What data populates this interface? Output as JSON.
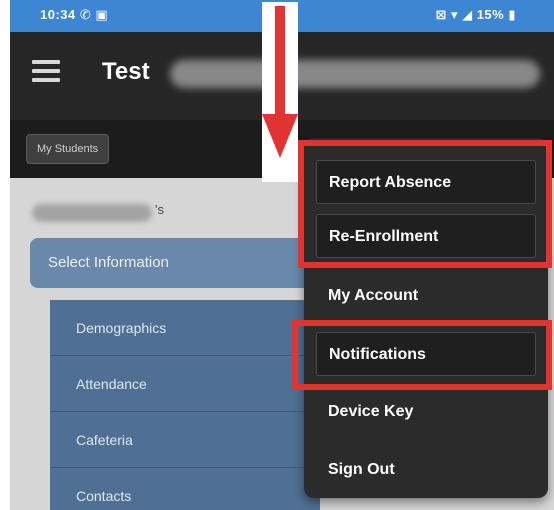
{
  "status_bar": {
    "time": "10:34 ✆ ▣",
    "indicators": "⊠ ▾ ◢ 15% ▮"
  },
  "app_bar": {
    "title": "Test",
    "menu_icon": "hamburger-menu-icon"
  },
  "sub_bar": {
    "chip_label": "My Students"
  },
  "student": {
    "name_suffix": "'s"
  },
  "content": {
    "select_label": "Select Information",
    "items": [
      "Demographics",
      "Attendance",
      "Cafeteria",
      "Contacts"
    ]
  },
  "menu": {
    "items": [
      "Report Absence",
      "Re-Enrollment",
      "My Account",
      "Notifications",
      "Device Key",
      "Sign Out"
    ]
  },
  "colors": {
    "annotation": "#e23333",
    "accent": "#3d86d4"
  }
}
